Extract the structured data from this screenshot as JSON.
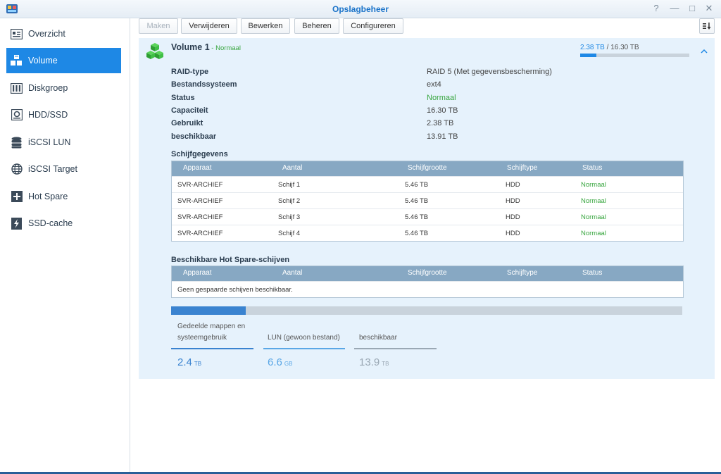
{
  "window": {
    "title": "Opslagbeheer",
    "controls": {
      "help": "?",
      "minimize": "—",
      "maximize": "□",
      "close": "✕"
    }
  },
  "sidebar": {
    "items": [
      {
        "label": "Overzicht",
        "icon": "overview-icon"
      },
      {
        "label": "Volume",
        "icon": "volume-icon",
        "active": true
      },
      {
        "label": "Diskgroep",
        "icon": "diskgroup-icon"
      },
      {
        "label": "HDD/SSD",
        "icon": "hdd-icon"
      },
      {
        "label": "iSCSI LUN",
        "icon": "database-icon"
      },
      {
        "label": "iSCSI Target",
        "icon": "globe-icon"
      },
      {
        "label": "Hot Spare",
        "icon": "plus-box-icon"
      },
      {
        "label": "SSD-cache",
        "icon": "lightning-icon"
      }
    ]
  },
  "toolbar": {
    "create": "Maken",
    "remove": "Verwijderen",
    "edit": "Bewerken",
    "manage": "Beheren",
    "configure": "Configureren"
  },
  "volume": {
    "name": "Volume 1",
    "status_sep": " - ",
    "status": "Normaal",
    "used": "2.38 TB",
    "separator": " / ",
    "total": "16.30 TB",
    "used_fraction": 0.146,
    "properties": [
      {
        "label": "RAID-type",
        "value": "RAID 5 (Met gegevensbescherming)"
      },
      {
        "label": "Bestandssysteem",
        "value": "ext4"
      },
      {
        "label": "Status",
        "value": "Normaal",
        "ok": true
      },
      {
        "label": "Capaciteit",
        "value": "16.30 TB"
      },
      {
        "label": "Gebruikt",
        "value": "2.38 TB"
      },
      {
        "label": "beschikbaar",
        "value": "13.91 TB"
      }
    ]
  },
  "disks": {
    "title": "Schijfgegevens",
    "headers": [
      "Apparaat",
      "Aantal",
      "Schijfgrootte",
      "Schijftype",
      "Status"
    ],
    "rows": [
      [
        "SVR-ARCHIEF",
        "Schijf 1",
        "5.46 TB",
        "HDD",
        "Normaal"
      ],
      [
        "SVR-ARCHIEF",
        "Schijf 2",
        "5.46 TB",
        "HDD",
        "Normaal"
      ],
      [
        "SVR-ARCHIEF",
        "Schijf 3",
        "5.46 TB",
        "HDD",
        "Normaal"
      ],
      [
        "SVR-ARCHIEF",
        "Schijf 4",
        "5.46 TB",
        "HDD",
        "Normaal"
      ]
    ]
  },
  "hotspare": {
    "title": "Beschikbare Hot Spare-schijven",
    "headers": [
      "Apparaat",
      "Aantal",
      "Schijfgrootte",
      "Schijftype",
      "Status"
    ],
    "empty": "Geen gespaarde schijven beschikbaar."
  },
  "breakdown": {
    "bar_fraction": 0.146,
    "items": [
      {
        "label1": "Gedeelde mappen en",
        "label2": "systeemgebruik",
        "value": "2.4",
        "unit": "TB",
        "color": "#3a83d0"
      },
      {
        "label1": "",
        "label2": "LUN (gewoon bestand)",
        "value": "6.6",
        "unit": "GB",
        "color": "#5aa7e6"
      },
      {
        "label1": "",
        "label2": "beschikbaar",
        "value": "13.9",
        "unit": "TB",
        "color": "#9aa8b4"
      }
    ]
  }
}
